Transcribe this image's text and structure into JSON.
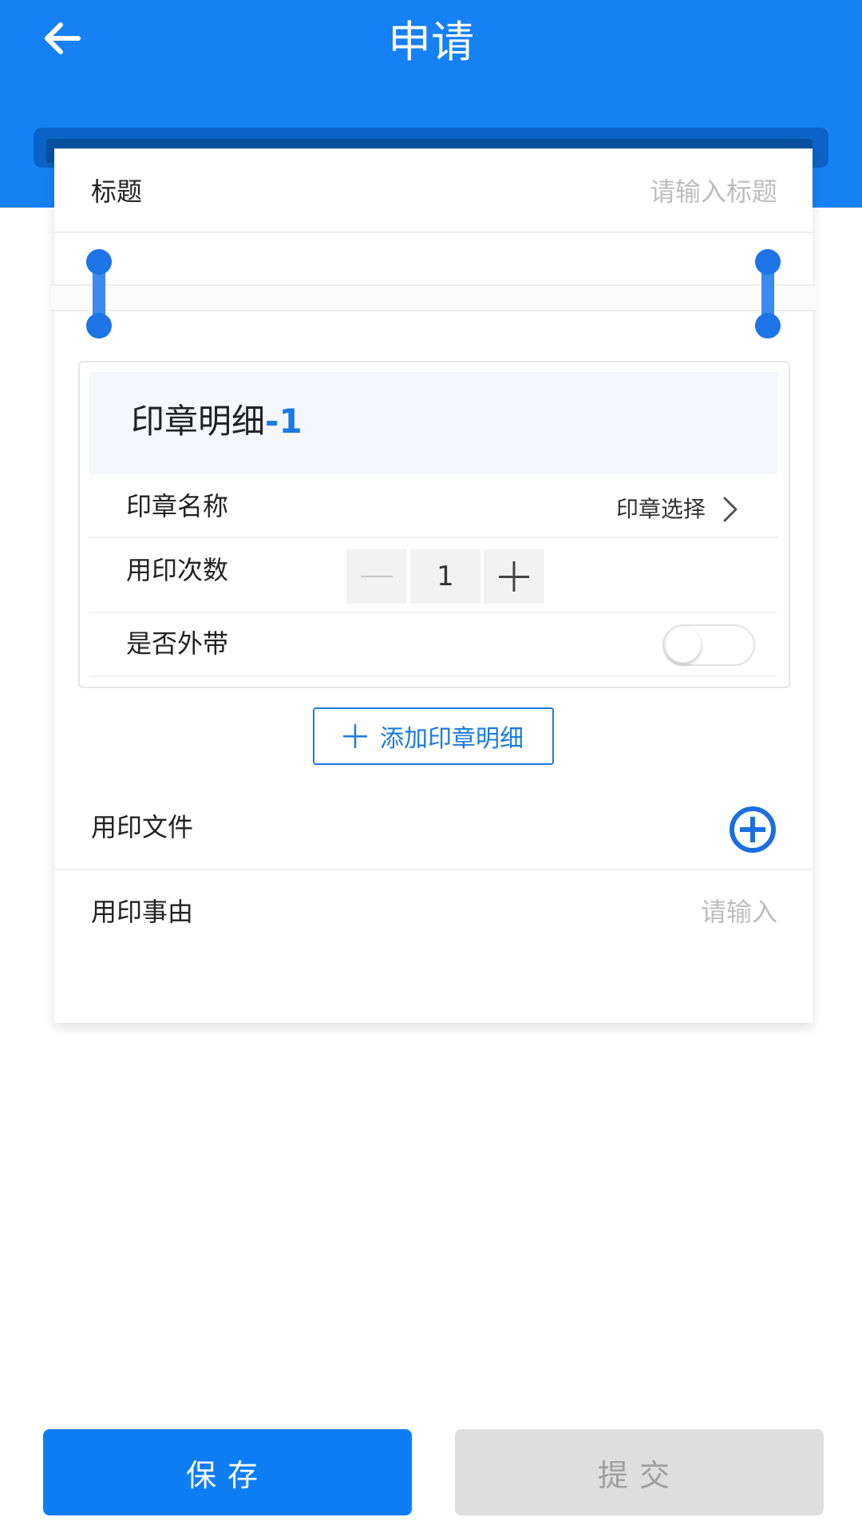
{
  "header": {
    "title": "申请",
    "back_icon": "arrow-left-icon",
    "background_color": "#1680f5"
  },
  "form": {
    "title_label": "标题",
    "title_placeholder": "请输入标题",
    "seal_detail": {
      "heading": "印章明细",
      "index": "-1",
      "name_label": "印章名称",
      "name_value": "印章选择",
      "count_label": "用印次数",
      "count_value": "1",
      "takeout_label": "是否外带",
      "takeout_enabled": false
    },
    "add_detail_label": "添加印章明细",
    "file_label": "用印文件",
    "reason_label": "用印事由",
    "reason_placeholder": "请输入"
  },
  "footer": {
    "save_label": "保存",
    "submit_label": "提交"
  },
  "colors": {
    "accent": "#1680f5",
    "link": "#1a7be0",
    "disabled": "#dedede"
  }
}
